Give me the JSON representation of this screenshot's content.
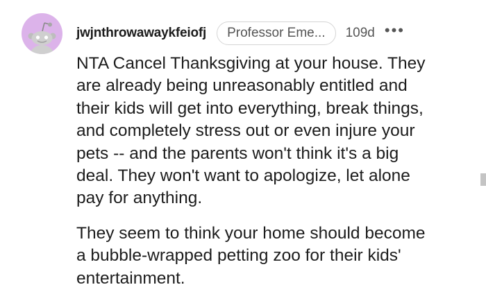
{
  "comment": {
    "username": "jwjnthrowawaykfeiofj",
    "flair": "Professor Eme...",
    "age": "109d",
    "more_icon": "more-dots-icon",
    "avatar_icon": "snoo-avatar-icon",
    "paragraphs": [
      "NTA Cancel Thanksgiving at your house. They\nare already being unreasonably entitled and\ntheir kids will get into everything, break things,\nand completely stress out or even injure your\npets -- and the parents won't think it's a big\ndeal. They won't want to apologize, let alone\npay for anything.",
      "They seem to think your home should become\na bubble-wrapped petting zoo for their kids'\nentertainment."
    ]
  },
  "colors": {
    "avatar_bg": "#dcb3ea",
    "text": "#1c1c1c",
    "meta": "#555555"
  }
}
